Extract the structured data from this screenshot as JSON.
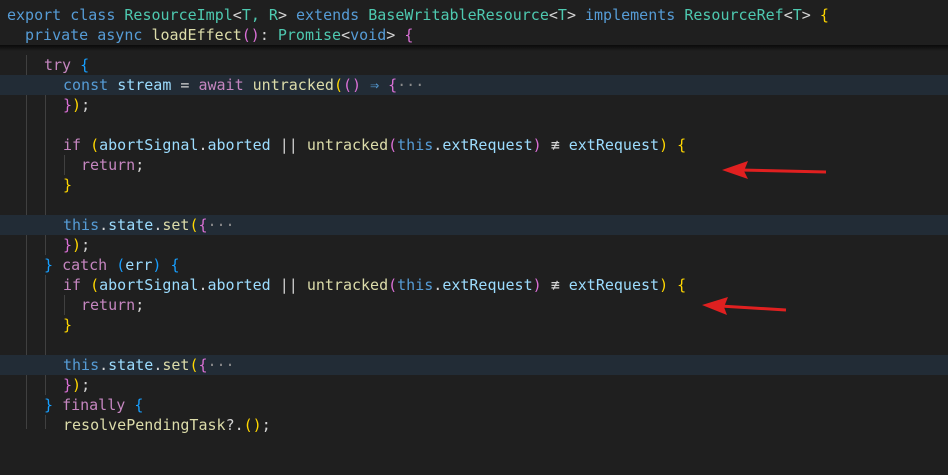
{
  "sticky": {
    "line1": {
      "export": "export",
      "class": "class",
      "className": "ResourceImpl",
      "lt": "<",
      "typeParams": "T, R",
      "gt": ">",
      "extends": "extends",
      "baseClass": "BaseWritableResource",
      "baseLt": "<",
      "baseT": "T",
      "baseGt": ">",
      "implements": "implements",
      "iface": "ResourceRef",
      "ifaceLt": "<",
      "ifaceT": "T",
      "ifaceGt": ">",
      "brace": "{"
    },
    "line2": {
      "private": "private",
      "async": "async",
      "method": "loadEffect",
      "parens": "()",
      "colon": ":",
      "promise": "Promise",
      "lt": "<",
      "void": "void",
      "gt": ">",
      "brace": "{"
    }
  },
  "code": {
    "try": "try",
    "brace_open": "{",
    "const": "const",
    "stream": "stream",
    "eq": "=",
    "await": "await",
    "untracked": "untracked",
    "paren_open": "(",
    "paren_pair": "()",
    "fat_arrow": "⇒",
    "fold": "···",
    "close_brace": "}",
    "close_paren": ")",
    "semi": ";",
    "if": "if",
    "abortSignal": "abortSignal",
    "dot": ".",
    "aborted": "aborted",
    "or": "||",
    "this": "this",
    "extRequest": "extRequest",
    "neq": "≢",
    "return": "return",
    "state": "state",
    "set": "set",
    "catch": "catch",
    "err": "err",
    "finally": "finally",
    "resolvePendingTask": "resolvePendingTask",
    "optcall": "?."
  },
  "annotations": {
    "arrow_color": "#e02020"
  }
}
